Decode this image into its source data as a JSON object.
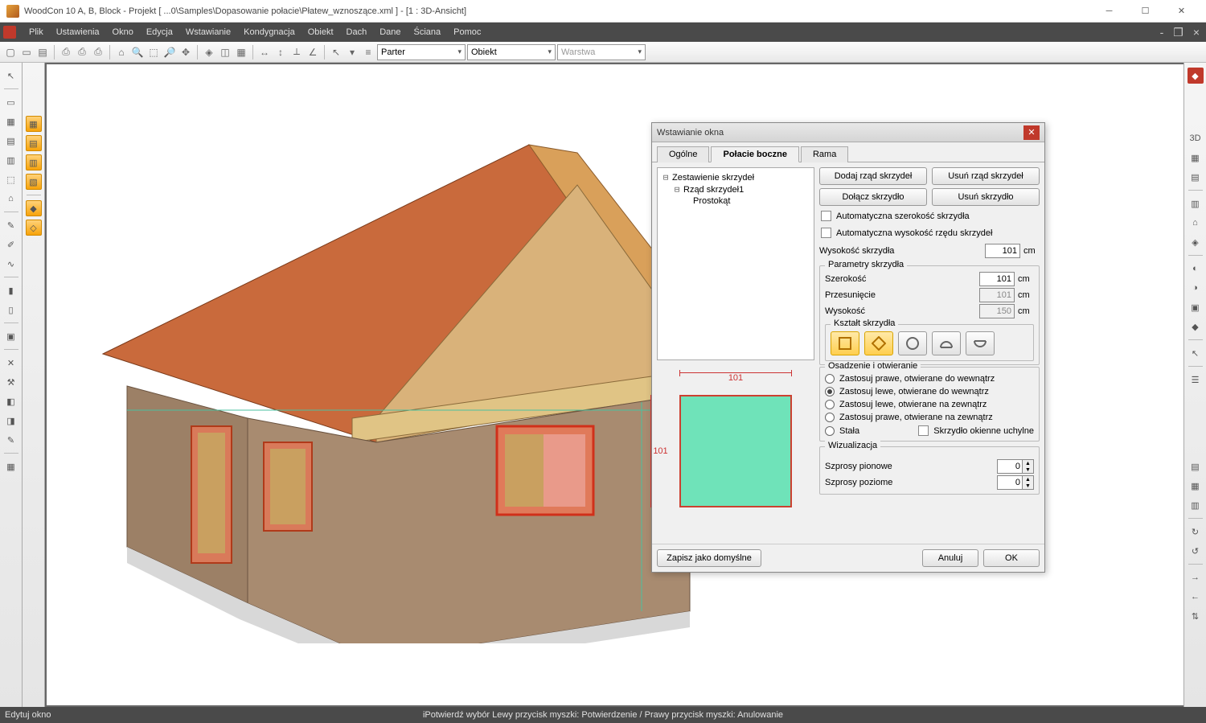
{
  "title": "WoodCon 10 A, B, Block - Projekt [ ...0\\Samples\\Dopasowanie połacie\\Płatew_wznoszące.xml ]  - [1 : 3D-Ansicht]",
  "menus": [
    "Plik",
    "Ustawienia",
    "Okno",
    "Edycja",
    "Wstawianie",
    "Kondygnacja",
    "Obiekt",
    "Dach",
    "Dane",
    "Ściana",
    "Pomoc"
  ],
  "combos": {
    "floor": "Parter",
    "category": "Obiekt",
    "layer": "Warstwa"
  },
  "statusbar": {
    "left": "Edytuj okno",
    "center": "iPotwierdź wybór Lewy przycisk myszki: Potwierdzenie / Prawy przycisk myszki: Anulowanie"
  },
  "dialog": {
    "title": "Wstawianie okna",
    "tabs": [
      "Ogólne",
      "Połacie boczne",
      "Rama"
    ],
    "active_tab": 1,
    "tree": {
      "root": "Zestawienie skrzydeł",
      "row": "Rząd skrzydeł1",
      "leaf": "Prostokąt"
    },
    "buttons": {
      "addRow": "Dodaj rząd skrzydeł",
      "delRow": "Usuń rząd skrzydeł",
      "addLeaf": "Dołącz skrzydło",
      "delLeaf": "Usuń skrzydło",
      "saveDefault": "Zapisz jako domyślne",
      "cancel": "Anuluj",
      "ok": "OK"
    },
    "checks": {
      "autoWidth": "Automatyczna szerokość skrzydła",
      "autoHeight": "Automatyczna wysokość rzędu skrzydeł"
    },
    "fields": {
      "sashHeight": {
        "label": "Wysokość skrzydła",
        "value": "101",
        "unit": "cm"
      },
      "paramsLegend": "Parametry skrzydła",
      "width": {
        "label": "Szerokość",
        "value": "101",
        "unit": "cm"
      },
      "offset": {
        "label": "Przesunięcie",
        "value": "101",
        "unit": "cm"
      },
      "height": {
        "label": "Wysokość",
        "value": "150",
        "unit": "cm"
      }
    },
    "shapeLegend": "Kształt skrzydła",
    "seatingLegend": "Osadzenie i otwieranie",
    "radios": [
      "Zastosuj prawe, otwierane do wewnątrz",
      "Zastosuj lewe, otwierane do wewnątrz",
      "Zastosuj lewe, otwierane na zewnątrz",
      "Zastosuj prawe, otwierane na zewnątrz",
      "Stała"
    ],
    "radio_selected": 1,
    "tilt": "Skrzydło okienne uchylne",
    "vizLegend": "Wizualizacja",
    "spins": {
      "vert": {
        "label": "Szprosy pionowe",
        "value": "0"
      },
      "horiz": {
        "label": "Szprosy poziome",
        "value": "0"
      }
    },
    "preview": {
      "w": "101",
      "h": "101"
    }
  }
}
